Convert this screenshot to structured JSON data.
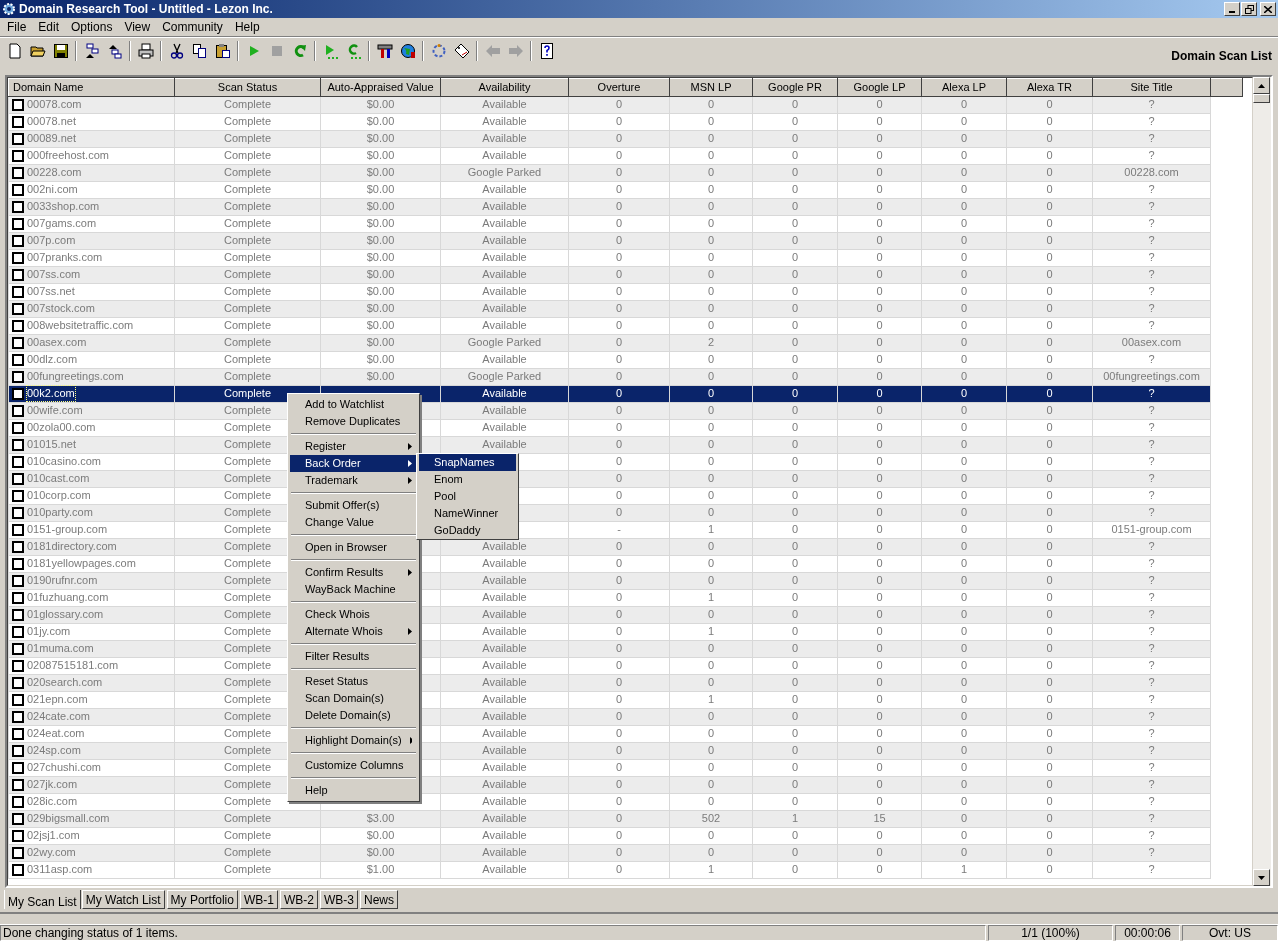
{
  "window": {
    "title": "Domain Research Tool - Untitled - Lezon Inc."
  },
  "menu_bar": [
    "File",
    "Edit",
    "Options",
    "View",
    "Community",
    "Help"
  ],
  "panel_title": "Domain Scan List",
  "columns": [
    "Domain Name",
    "Scan Status",
    "Auto-Appraised Value",
    "Availability",
    "Overture",
    "MSN LP",
    "Google PR",
    "Google LP",
    "Alexa LP",
    "Alexa TR",
    "Site Title"
  ],
  "rows": [
    {
      "checked": false,
      "selected": false,
      "domain": "00078.com",
      "scan_status": "Complete",
      "value": "$0.00",
      "availability": "Available",
      "overture": "0",
      "msn_lp": "0",
      "google_pr": "0",
      "google_lp": "0",
      "alexa_lp": "0",
      "alexa_tr": "0",
      "site_title": "?"
    },
    {
      "checked": false,
      "selected": false,
      "domain": "00078.net",
      "scan_status": "Complete",
      "value": "$0.00",
      "availability": "Available",
      "overture": "0",
      "msn_lp": "0",
      "google_pr": "0",
      "google_lp": "0",
      "alexa_lp": "0",
      "alexa_tr": "0",
      "site_title": "?"
    },
    {
      "checked": false,
      "selected": false,
      "domain": "00089.net",
      "scan_status": "Complete",
      "value": "$0.00",
      "availability": "Available",
      "overture": "0",
      "msn_lp": "0",
      "google_pr": "0",
      "google_lp": "0",
      "alexa_lp": "0",
      "alexa_tr": "0",
      "site_title": "?"
    },
    {
      "checked": false,
      "selected": false,
      "domain": "000freehost.com",
      "scan_status": "Complete",
      "value": "$0.00",
      "availability": "Available",
      "overture": "0",
      "msn_lp": "0",
      "google_pr": "0",
      "google_lp": "0",
      "alexa_lp": "0",
      "alexa_tr": "0",
      "site_title": "?"
    },
    {
      "checked": false,
      "selected": false,
      "domain": "00228.com",
      "scan_status": "Complete",
      "value": "$0.00",
      "availability": "Google Parked",
      "overture": "0",
      "msn_lp": "0",
      "google_pr": "0",
      "google_lp": "0",
      "alexa_lp": "0",
      "alexa_tr": "0",
      "site_title": "00228.com"
    },
    {
      "checked": false,
      "selected": false,
      "domain": "002ni.com",
      "scan_status": "Complete",
      "value": "$0.00",
      "availability": "Available",
      "overture": "0",
      "msn_lp": "0",
      "google_pr": "0",
      "google_lp": "0",
      "alexa_lp": "0",
      "alexa_tr": "0",
      "site_title": "?"
    },
    {
      "checked": false,
      "selected": false,
      "domain": "0033shop.com",
      "scan_status": "Complete",
      "value": "$0.00",
      "availability": "Available",
      "overture": "0",
      "msn_lp": "0",
      "google_pr": "0",
      "google_lp": "0",
      "alexa_lp": "0",
      "alexa_tr": "0",
      "site_title": "?"
    },
    {
      "checked": false,
      "selected": false,
      "domain": "007gams.com",
      "scan_status": "Complete",
      "value": "$0.00",
      "availability": "Available",
      "overture": "0",
      "msn_lp": "0",
      "google_pr": "0",
      "google_lp": "0",
      "alexa_lp": "0",
      "alexa_tr": "0",
      "site_title": "?"
    },
    {
      "checked": false,
      "selected": false,
      "domain": "007p.com",
      "scan_status": "Complete",
      "value": "$0.00",
      "availability": "Available",
      "overture": "0",
      "msn_lp": "0",
      "google_pr": "0",
      "google_lp": "0",
      "alexa_lp": "0",
      "alexa_tr": "0",
      "site_title": "?"
    },
    {
      "checked": false,
      "selected": false,
      "domain": "007pranks.com",
      "scan_status": "Complete",
      "value": "$0.00",
      "availability": "Available",
      "overture": "0",
      "msn_lp": "0",
      "google_pr": "0",
      "google_lp": "0",
      "alexa_lp": "0",
      "alexa_tr": "0",
      "site_title": "?"
    },
    {
      "checked": false,
      "selected": false,
      "domain": "007ss.com",
      "scan_status": "Complete",
      "value": "$0.00",
      "availability": "Available",
      "overture": "0",
      "msn_lp": "0",
      "google_pr": "0",
      "google_lp": "0",
      "alexa_lp": "0",
      "alexa_tr": "0",
      "site_title": "?"
    },
    {
      "checked": false,
      "selected": false,
      "domain": "007ss.net",
      "scan_status": "Complete",
      "value": "$0.00",
      "availability": "Available",
      "overture": "0",
      "msn_lp": "0",
      "google_pr": "0",
      "google_lp": "0",
      "alexa_lp": "0",
      "alexa_tr": "0",
      "site_title": "?"
    },
    {
      "checked": false,
      "selected": false,
      "domain": "007stock.com",
      "scan_status": "Complete",
      "value": "$0.00",
      "availability": "Available",
      "overture": "0",
      "msn_lp": "0",
      "google_pr": "0",
      "google_lp": "0",
      "alexa_lp": "0",
      "alexa_tr": "0",
      "site_title": "?"
    },
    {
      "checked": false,
      "selected": false,
      "domain": "008websitetraffic.com",
      "scan_status": "Complete",
      "value": "$0.00",
      "availability": "Available",
      "overture": "0",
      "msn_lp": "0",
      "google_pr": "0",
      "google_lp": "0",
      "alexa_lp": "0",
      "alexa_tr": "0",
      "site_title": "?"
    },
    {
      "checked": false,
      "selected": false,
      "domain": "00asex.com",
      "scan_status": "Complete",
      "value": "$0.00",
      "availability": "Google Parked",
      "overture": "0",
      "msn_lp": "2",
      "google_pr": "0",
      "google_lp": "0",
      "alexa_lp": "0",
      "alexa_tr": "0",
      "site_title": "00asex.com"
    },
    {
      "checked": false,
      "selected": false,
      "domain": "00dlz.com",
      "scan_status": "Complete",
      "value": "$0.00",
      "availability": "Available",
      "overture": "0",
      "msn_lp": "0",
      "google_pr": "0",
      "google_lp": "0",
      "alexa_lp": "0",
      "alexa_tr": "0",
      "site_title": "?"
    },
    {
      "checked": false,
      "selected": false,
      "domain": "00fungreetings.com",
      "scan_status": "Complete",
      "value": "$0.00",
      "availability": "Google Parked",
      "overture": "0",
      "msn_lp": "0",
      "google_pr": "0",
      "google_lp": "0",
      "alexa_lp": "0",
      "alexa_tr": "0",
      "site_title": "00fungreetings.com"
    },
    {
      "checked": false,
      "selected": true,
      "domain": "00k2.com",
      "scan_status": "Complete",
      "availability": "Available",
      "overture": "0",
      "msn_lp": "0",
      "google_pr": "0",
      "google_lp": "0",
      "alexa_lp": "0",
      "alexa_tr": "0",
      "site_title": "?"
    },
    {
      "checked": false,
      "selected": false,
      "domain": "00wife.com",
      "scan_status": "Complete",
      "availability": "Available",
      "overture": "0",
      "msn_lp": "0",
      "google_pr": "0",
      "google_lp": "0",
      "alexa_lp": "0",
      "alexa_tr": "0",
      "site_title": "?"
    },
    {
      "checked": false,
      "selected": false,
      "domain": "00zola00.com",
      "scan_status": "Complete",
      "availability": "Available",
      "overture": "0",
      "msn_lp": "0",
      "google_pr": "0",
      "google_lp": "0",
      "alexa_lp": "0",
      "alexa_tr": "0",
      "site_title": "?"
    },
    {
      "checked": false,
      "selected": false,
      "domain": "01015.net",
      "scan_status": "Complete",
      "availability": "Available",
      "overture": "0",
      "msn_lp": "0",
      "google_pr": "0",
      "google_lp": "0",
      "alexa_lp": "0",
      "alexa_tr": "0",
      "site_title": "?"
    },
    {
      "checked": false,
      "selected": false,
      "domain": "010casino.com",
      "scan_status": "Complete",
      "overture": "0",
      "msn_lp": "0",
      "google_pr": "0",
      "google_lp": "0",
      "alexa_lp": "0",
      "alexa_tr": "0",
      "site_title": "?"
    },
    {
      "checked": false,
      "selected": false,
      "domain": "010cast.com",
      "scan_status": "Complete",
      "overture": "0",
      "msn_lp": "0",
      "google_pr": "0",
      "google_lp": "0",
      "alexa_lp": "0",
      "alexa_tr": "0",
      "site_title": "?"
    },
    {
      "checked": false,
      "selected": false,
      "domain": "010corp.com",
      "scan_status": "Complete",
      "overture": "0",
      "msn_lp": "0",
      "google_pr": "0",
      "google_lp": "0",
      "alexa_lp": "0",
      "alexa_tr": "0",
      "site_title": "?"
    },
    {
      "checked": false,
      "selected": false,
      "domain": "010party.com",
      "scan_status": "Complete",
      "overture": "0",
      "msn_lp": "0",
      "google_pr": "0",
      "google_lp": "0",
      "alexa_lp": "0",
      "alexa_tr": "0",
      "site_title": "?"
    },
    {
      "checked": false,
      "selected": false,
      "domain": "0151-group.com",
      "scan_status": "Complete",
      "overture": "-",
      "msn_lp": "1",
      "google_pr": "0",
      "google_lp": "0",
      "alexa_lp": "0",
      "alexa_tr": "0",
      "site_title": "0151-group.com"
    },
    {
      "checked": false,
      "selected": false,
      "domain": "0181directory.com",
      "scan_status": "Complete",
      "availability": "Available",
      "overture": "0",
      "msn_lp": "0",
      "google_pr": "0",
      "google_lp": "0",
      "alexa_lp": "0",
      "alexa_tr": "0",
      "site_title": "?"
    },
    {
      "checked": false,
      "selected": false,
      "domain": "0181yellowpages.com",
      "scan_status": "Complete",
      "availability": "Available",
      "overture": "0",
      "msn_lp": "0",
      "google_pr": "0",
      "google_lp": "0",
      "alexa_lp": "0",
      "alexa_tr": "0",
      "site_title": "?"
    },
    {
      "checked": false,
      "selected": false,
      "domain": "0190rufnr.com",
      "scan_status": "Complete",
      "availability": "Available",
      "overture": "0",
      "msn_lp": "0",
      "google_pr": "0",
      "google_lp": "0",
      "alexa_lp": "0",
      "alexa_tr": "0",
      "site_title": "?"
    },
    {
      "checked": false,
      "selected": false,
      "domain": "01fuzhuang.com",
      "scan_status": "Complete",
      "availability": "Available",
      "overture": "0",
      "msn_lp": "1",
      "google_pr": "0",
      "google_lp": "0",
      "alexa_lp": "0",
      "alexa_tr": "0",
      "site_title": "?"
    },
    {
      "checked": false,
      "selected": false,
      "domain": "01glossary.com",
      "scan_status": "Complete",
      "availability": "Available",
      "overture": "0",
      "msn_lp": "0",
      "google_pr": "0",
      "google_lp": "0",
      "alexa_lp": "0",
      "alexa_tr": "0",
      "site_title": "?"
    },
    {
      "checked": false,
      "selected": false,
      "domain": "01jy.com",
      "scan_status": "Complete",
      "availability": "Available",
      "overture": "0",
      "msn_lp": "1",
      "google_pr": "0",
      "google_lp": "0",
      "alexa_lp": "0",
      "alexa_tr": "0",
      "site_title": "?"
    },
    {
      "checked": false,
      "selected": false,
      "domain": "01muma.com",
      "scan_status": "Complete",
      "availability": "Available",
      "overture": "0",
      "msn_lp": "0",
      "google_pr": "0",
      "google_lp": "0",
      "alexa_lp": "0",
      "alexa_tr": "0",
      "site_title": "?"
    },
    {
      "checked": false,
      "selected": false,
      "domain": "02087515181.com",
      "scan_status": "Complete",
      "availability": "Available",
      "overture": "0",
      "msn_lp": "0",
      "google_pr": "0",
      "google_lp": "0",
      "alexa_lp": "0",
      "alexa_tr": "0",
      "site_title": "?"
    },
    {
      "checked": false,
      "selected": false,
      "domain": "020search.com",
      "scan_status": "Complete",
      "availability": "Available",
      "overture": "0",
      "msn_lp": "0",
      "google_pr": "0",
      "google_lp": "0",
      "alexa_lp": "0",
      "alexa_tr": "0",
      "site_title": "?"
    },
    {
      "checked": false,
      "selected": false,
      "domain": "021epn.com",
      "scan_status": "Complete",
      "availability": "Available",
      "overture": "0",
      "msn_lp": "1",
      "google_pr": "0",
      "google_lp": "0",
      "alexa_lp": "0",
      "alexa_tr": "0",
      "site_title": "?"
    },
    {
      "checked": false,
      "selected": false,
      "domain": "024cate.com",
      "scan_status": "Complete",
      "availability": "Available",
      "overture": "0",
      "msn_lp": "0",
      "google_pr": "0",
      "google_lp": "0",
      "alexa_lp": "0",
      "alexa_tr": "0",
      "site_title": "?"
    },
    {
      "checked": false,
      "selected": false,
      "domain": "024eat.com",
      "scan_status": "Complete",
      "availability": "Available",
      "overture": "0",
      "msn_lp": "0",
      "google_pr": "0",
      "google_lp": "0",
      "alexa_lp": "0",
      "alexa_tr": "0",
      "site_title": "?"
    },
    {
      "checked": false,
      "selected": false,
      "domain": "024sp.com",
      "scan_status": "Complete",
      "availability": "Available",
      "overture": "0",
      "msn_lp": "0",
      "google_pr": "0",
      "google_lp": "0",
      "alexa_lp": "0",
      "alexa_tr": "0",
      "site_title": "?"
    },
    {
      "checked": false,
      "selected": false,
      "domain": "027chushi.com",
      "scan_status": "Complete",
      "availability": "Available",
      "overture": "0",
      "msn_lp": "0",
      "google_pr": "0",
      "google_lp": "0",
      "alexa_lp": "0",
      "alexa_tr": "0",
      "site_title": "?"
    },
    {
      "checked": false,
      "selected": false,
      "domain": "027jk.com",
      "scan_status": "Complete",
      "availability": "Available",
      "overture": "0",
      "msn_lp": "0",
      "google_pr": "0",
      "google_lp": "0",
      "alexa_lp": "0",
      "alexa_tr": "0",
      "site_title": "?"
    },
    {
      "checked": false,
      "selected": false,
      "domain": "028ic.com",
      "scan_status": "Complete",
      "availability": "Available",
      "overture": "0",
      "msn_lp": "0",
      "google_pr": "0",
      "google_lp": "0",
      "alexa_lp": "0",
      "alexa_tr": "0",
      "site_title": "?"
    },
    {
      "checked": false,
      "selected": false,
      "domain": "029bigsmall.com",
      "scan_status": "Complete",
      "value": "$3.00",
      "availability": "Available",
      "overture": "0",
      "msn_lp": "502",
      "google_pr": "1",
      "google_lp": "15",
      "alexa_lp": "0",
      "alexa_tr": "0",
      "site_title": "?"
    },
    {
      "checked": false,
      "selected": false,
      "domain": "02jsj1.com",
      "scan_status": "Complete",
      "value": "$0.00",
      "availability": "Available",
      "overture": "0",
      "msn_lp": "0",
      "google_pr": "0",
      "google_lp": "0",
      "alexa_lp": "0",
      "alexa_tr": "0",
      "site_title": "?"
    },
    {
      "checked": false,
      "selected": false,
      "domain": "02wy.com",
      "scan_status": "Complete",
      "value": "$0.00",
      "availability": "Available",
      "overture": "0",
      "msn_lp": "0",
      "google_pr": "0",
      "google_lp": "0",
      "alexa_lp": "0",
      "alexa_tr": "0",
      "site_title": "?"
    },
    {
      "checked": false,
      "selected": false,
      "domain": "0311asp.com",
      "scan_status": "Complete",
      "value": "$1.00",
      "availability": "Available",
      "overture": "0",
      "msn_lp": "1",
      "google_pr": "0",
      "google_lp": "0",
      "alexa_lp": "1",
      "alexa_tr": "0",
      "site_title": "?"
    }
  ],
  "context_menu": {
    "groups": [
      [
        {
          "label": "Add to Watchlist",
          "submenu": false,
          "selected": false
        },
        {
          "label": "Remove Duplicates",
          "submenu": false,
          "selected": false
        }
      ],
      [
        {
          "label": "Register",
          "submenu": true,
          "selected": false
        },
        {
          "label": "Back Order",
          "submenu": true,
          "selected": true
        },
        {
          "label": "Trademark",
          "submenu": true,
          "selected": false
        }
      ],
      [
        {
          "label": "Submit Offer(s)",
          "submenu": false,
          "selected": false
        },
        {
          "label": "Change Value",
          "submenu": false,
          "selected": false
        }
      ],
      [
        {
          "label": "Open in Browser",
          "submenu": false,
          "selected": false
        }
      ],
      [
        {
          "label": "Confirm Results",
          "submenu": true,
          "selected": false
        },
        {
          "label": "WayBack Machine",
          "submenu": false,
          "selected": false
        }
      ],
      [
        {
          "label": "Check Whois",
          "submenu": false,
          "selected": false
        },
        {
          "label": "Alternate Whois",
          "submenu": true,
          "selected": false
        }
      ],
      [
        {
          "label": "Filter Results",
          "submenu": false,
          "selected": false
        }
      ],
      [
        {
          "label": "Reset Status",
          "submenu": false,
          "selected": false
        },
        {
          "label": "Scan Domain(s)",
          "submenu": false,
          "selected": false
        },
        {
          "label": "Delete Domain(s)",
          "submenu": false,
          "selected": false
        }
      ],
      [
        {
          "label": "Highlight Domain(s)",
          "submenu": true,
          "selected": false
        }
      ],
      [
        {
          "label": "Customize Columns",
          "submenu": false,
          "selected": false
        }
      ],
      [
        {
          "label": "Help",
          "submenu": false,
          "selected": false
        }
      ]
    ]
  },
  "submenu": [
    {
      "label": "SnapNames",
      "selected": true
    },
    {
      "label": "Enom",
      "selected": false
    },
    {
      "label": "Pool",
      "selected": false
    },
    {
      "label": "NameWinner",
      "selected": false
    },
    {
      "label": "GoDaddy",
      "selected": false
    }
  ],
  "tabs": [
    {
      "label": "My Scan List",
      "selected": true
    },
    {
      "label": "My Watch List",
      "selected": false
    },
    {
      "label": "My Portfolio",
      "selected": false
    },
    {
      "label": "WB-1",
      "selected": false
    },
    {
      "label": "WB-2",
      "selected": false
    },
    {
      "label": "WB-3",
      "selected": false
    },
    {
      "label": "News",
      "selected": false
    }
  ],
  "status_bar": {
    "message": "Done changing status of 1 items.",
    "progress": "1/1 (100%)",
    "elapsed": "00:00:06",
    "region": "Ovt: US"
  }
}
